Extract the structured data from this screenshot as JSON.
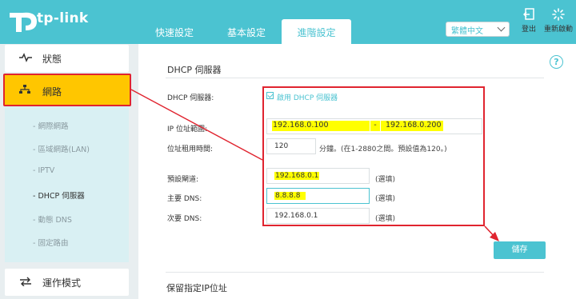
{
  "brand": {
    "logo_text": "tp-link"
  },
  "nav": {
    "tabs": [
      "快速設定",
      "基本設定",
      "進階設定"
    ],
    "language": "繁體中文",
    "logout_label": "登出",
    "reboot_label": "重新啟動"
  },
  "sidebar": {
    "items": [
      {
        "label": "狀態"
      },
      {
        "label": "網路"
      },
      {
        "label": "運作模式"
      }
    ],
    "sub_items": [
      "網際網路",
      "區域網路(LAN)",
      "IPTV",
      "DHCP 伺服器",
      "動態 DNS",
      "固定路由"
    ]
  },
  "dhcp": {
    "title": "DHCP 伺服器",
    "server_label": "DHCP 伺服器:",
    "enable_label": "啟用 DHCP 伺服器",
    "enabled": true,
    "range_label": "IP 位址範圍:",
    "range_start": "192.168.0.100",
    "range_dash": "-",
    "range_end": "192.168.0.200",
    "lease_label": "位址租用時間:",
    "lease_value": "120",
    "lease_note": "分鐘。(在1-2880之間。預設值為120。)",
    "gateway_label": "預設閘道:",
    "gateway_value": "192.168.0.1",
    "primary_dns_label": "主要 DNS:",
    "primary_dns_value": "8.8.8.8",
    "secondary_dns_label": "次要 DNS:",
    "secondary_dns_value": "192.168.0.1",
    "optional_note": "(選填)",
    "save_label": "儲存"
  },
  "reserved": {
    "title": "保留指定IP位址"
  },
  "help_glyph": "?",
  "colors": {
    "accent": "#4bc3d1",
    "highlight": "#ffff00",
    "annotation": "#e0242f",
    "active_nav": "#ffc600"
  }
}
